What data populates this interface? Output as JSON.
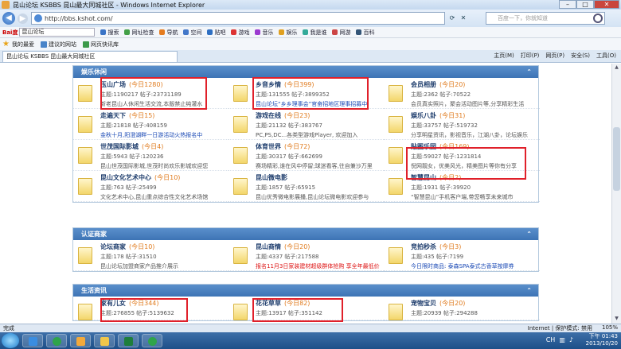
{
  "window": {
    "title": "昆山论坛 KSBBS 昆山最大同城社区 - Windows Internet Explorer",
    "min": "–",
    "max": "□",
    "close": "✕"
  },
  "address": {
    "url": "http://bbs.kshot.com/",
    "search_placeholder": "百度一下，你就知道"
  },
  "toolbar": {
    "brand": "Bai度",
    "search_value": "昆山论坛",
    "items": [
      "搜索",
      "网址检查",
      "导航",
      "空间",
      "贴吧",
      "游戏",
      "音乐",
      "娱乐",
      "我是谁",
      "网游",
      "百科"
    ]
  },
  "favbar": {
    "label": "我的最爱",
    "items": [
      "建议的网站",
      "网页快讯库"
    ]
  },
  "tab": {
    "title": "昆山论坛 KSBBS 昆山最大同城社区",
    "commands": [
      "主页(M)",
      "打印(P)",
      "网页(P)",
      "安全(S)",
      "工具(O)"
    ]
  },
  "sections": [
    {
      "title": "娱乐休闲",
      "forums": [
        {
          "name": "玉山广场",
          "today": "(今日1280)",
          "stats": "主题:1190217  帖子:23731189",
          "desc": "新老昆山人休闲生活交流,本版禁止纯灌水",
          "desc_color": "normal"
        },
        {
          "name": "乡音乡情",
          "today": "(今日399)",
          "stats": "主题:131555  帖子:3899352",
          "desc": "昆山论坛“乡乡理事会”官奋招地区理事招募中",
          "desc_color": "blue"
        },
        {
          "name": "会员相册",
          "today": "(今日20)",
          "stats": "主题:2362  帖子:70522",
          "desc": "会员真实照片，聚会活动图片等,分享精彩生活",
          "desc_color": "normal"
        },
        {
          "name": "走遍天下",
          "today": "(今日15)",
          "stats": "主题:21818  帖子:408159",
          "desc": "金秋十月,阳澄湖畔一日游活动火热报名中",
          "desc_color": "blue"
        },
        {
          "name": "游戏在线",
          "today": "(今日23)",
          "stats": "主题:21132  帖子:383767",
          "desc": "PC,PS,DC...各类型游戏Player, 欢迎加入",
          "desc_color": "normal"
        },
        {
          "name": "娱乐八卦",
          "today": "(今日31)",
          "stats": "主题:33757  帖子:519732",
          "desc": "分享明星资讯，影视音乐，江湖八卦，论坛娱乐",
          "desc_color": "normal"
        },
        {
          "name": "世茂国际影城",
          "today": "(今日4)",
          "stats": "主题:5943  帖子:120236",
          "desc": "昆山世茂国际影城,世茂时尚欢乐影城欢迎您",
          "desc_color": "normal"
        },
        {
          "name": "体育世界",
          "today": "(今日72)",
          "stats": "主题:30317  帖子:662699",
          "desc": "赛场精彩,谁在风中停留;球迷看客,往自兼沙万里",
          "desc_color": "normal"
        },
        {
          "name": "贴图乐园",
          "today": "(今日169)",
          "stats": "主题:59027  帖子:1231814",
          "desc": "倪网靓女，优美风光，精美图片等你有分享",
          "desc_color": "normal"
        },
        {
          "name": "昆山文化艺术中心",
          "today": "(今日10)",
          "stats": "主题:763  帖子:25499",
          "desc": "文化艺术中心,昆山重点综合性文化艺术场馆",
          "desc_color": "normal"
        },
        {
          "name": "昆山微电影",
          "today": "",
          "stats": "主题:1857  帖子:65915",
          "desc": "昆山优秀微电影展播,昆山论坛微电影欢迎参与",
          "desc_color": "normal"
        },
        {
          "name": "智慧昆山",
          "today": "(今日2)",
          "stats": "主题:1931  帖子:39920",
          "desc": "“智慧昆山”手机客户端,带您畅享未来城市",
          "desc_color": "normal"
        }
      ]
    },
    {
      "title": "认证商家",
      "forums": [
        {
          "name": "论坛商家",
          "today": "(今日10)",
          "stats": "主题:178  帖子:31510",
          "desc": "昆山论坛加盟商家产品推介展示",
          "desc_color": "normal"
        },
        {
          "name": "昆山商情",
          "today": "(今日20)",
          "stats": "主题:4337  帖子:217588",
          "desc": "报名11月3日家装建材超级群体抢购 享全年最低价",
          "desc_color": "red"
        },
        {
          "name": "竞拍秒杀",
          "today": "(今日3)",
          "stats": "主题:435  帖子:7199",
          "desc": "今日限时商品: 泰森SPA泰式古香草按摩券",
          "desc_color": "blue"
        }
      ]
    },
    {
      "title": "生活资讯",
      "forums": [
        {
          "name": "家有儿女",
          "today": "(今日344)",
          "stats": "主题:276855  帖子:5139632",
          "desc": "",
          "desc_color": "normal"
        },
        {
          "name": "花花草草",
          "today": "(今日82)",
          "stats": "主题:13917  帖子:351142",
          "desc": "",
          "desc_color": "normal"
        },
        {
          "name": "宠物宝贝",
          "today": "(今日20)",
          "stats": "主题:20939  帖子:294288",
          "desc": "",
          "desc_color": "normal"
        }
      ]
    }
  ],
  "statusbar": {
    "left": "完成",
    "zone": "Internet | 保护模式: 禁用",
    "zoom": "105%"
  },
  "taskbar": {
    "lang": "CH",
    "time": "下午 01:43",
    "date": "2013/10/20"
  }
}
